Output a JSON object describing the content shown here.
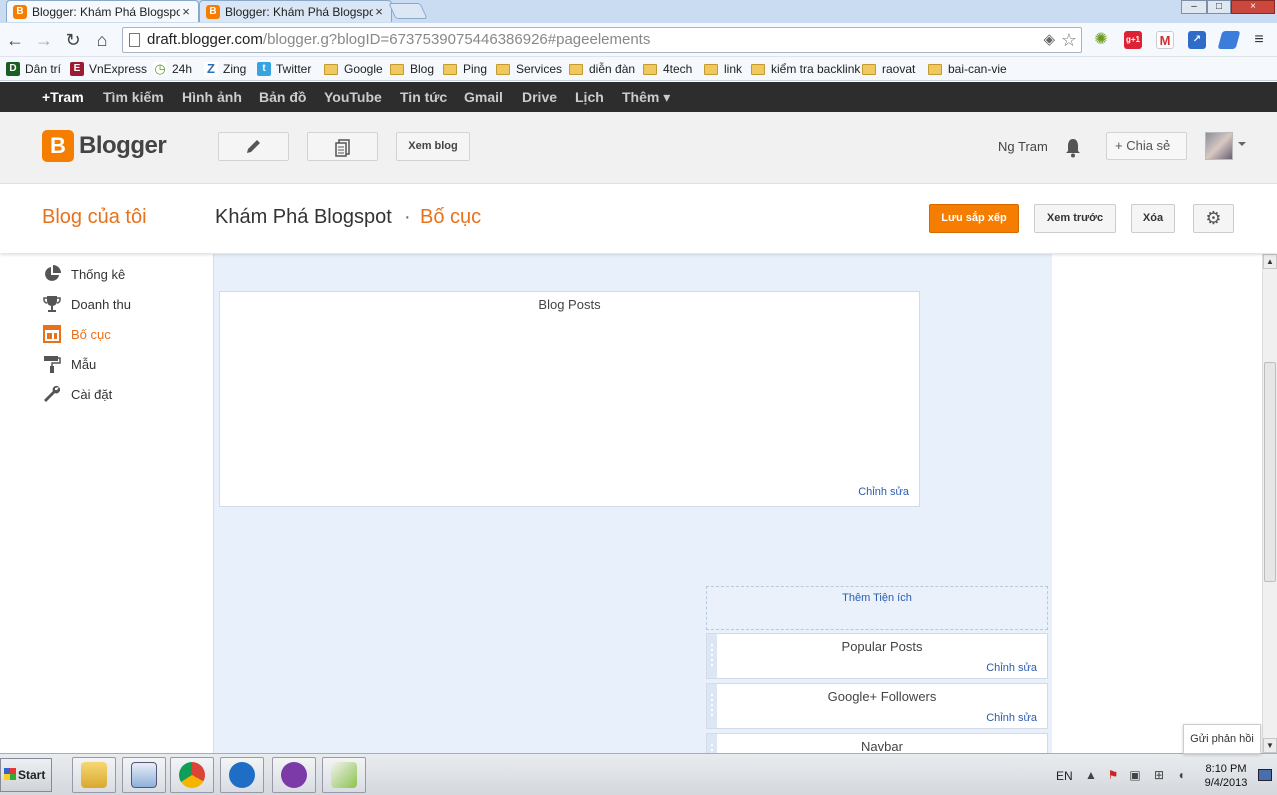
{
  "browser": {
    "tabs": [
      {
        "title": "Blogger: Khám Phá Blogspot",
        "active": true,
        "close": "×"
      },
      {
        "title": "Blogger: Khám Phá Blogspot",
        "active": false,
        "close": "×"
      }
    ],
    "window_controls": [
      "–",
      "□",
      "×"
    ],
    "url": {
      "host": "draft.blogger.com",
      "path": "/blogger.g?blogID=6737539075446386926#pageelements"
    },
    "nav": {
      "back": "←",
      "forward": "→",
      "reload": "↻",
      "home": "⌂"
    },
    "bookmarks": [
      {
        "label": "Dân trí",
        "icon": "dantri-icon",
        "color": "#1a5e20",
        "glyph": "D"
      },
      {
        "label": "VnExpress",
        "icon": "vnexpress-icon",
        "color": "#9b1c31",
        "glyph": "E"
      },
      {
        "label": "24h",
        "icon": "24h-icon",
        "color": "#5aa02c",
        "glyph": "◷"
      },
      {
        "label": "Zing",
        "icon": "zing-icon",
        "color": "#2e6fb6",
        "glyph": "Z"
      },
      {
        "label": "Twitter",
        "icon": "twitter-icon",
        "color": "#35a4e0",
        "glyph": "t"
      },
      {
        "label": "Google",
        "icon": "folder-icon"
      },
      {
        "label": "Blog",
        "icon": "folder-icon"
      },
      {
        "label": "Ping",
        "icon": "folder-icon"
      },
      {
        "label": "Services",
        "icon": "folder-icon"
      },
      {
        "label": "diễn đàn",
        "icon": "folder-icon"
      },
      {
        "label": "4tech",
        "icon": "folder-icon"
      },
      {
        "label": "link",
        "icon": "folder-icon"
      },
      {
        "label": "kiểm tra backlink",
        "icon": "folder-icon"
      },
      {
        "label": "raovat",
        "icon": "folder-icon"
      },
      {
        "label": "bai-can-vie",
        "icon": "folder-icon"
      }
    ]
  },
  "gbar": {
    "items": [
      "+Tram",
      "Tìm kiếm",
      "Hình ảnh",
      "Bản đồ",
      "YouTube",
      "Tin tức",
      "Gmail",
      "Drive",
      "Lịch",
      "Thêm ▾"
    ]
  },
  "header": {
    "logo_letter": "B",
    "logo_text": "Blogger",
    "view_blog": "Xem blog",
    "user_name": "Ng Tram",
    "share": "+  Chia sẻ"
  },
  "titlerow": {
    "my_blog": "Blog của tôi",
    "blog_name": "Khám Phá Blogspot",
    "separator": "·",
    "section": "Bố cục",
    "save_arrangement": "Lưu sắp xếp",
    "preview": "Xem trước",
    "clear": "Xóa"
  },
  "sidebar": {
    "items": [
      {
        "label": "Thống kê",
        "icon": "pie-chart-icon",
        "active": false
      },
      {
        "label": "Doanh thu",
        "icon": "trophy-icon",
        "active": false
      },
      {
        "label": "Bố cục",
        "icon": "layout-icon",
        "active": true
      },
      {
        "label": "Mẫu",
        "icon": "paint-roller-icon",
        "active": false
      },
      {
        "label": "Cài đặt",
        "icon": "wrench-icon",
        "active": false
      }
    ]
  },
  "layout": {
    "main_gadget": {
      "title": "Blog Posts",
      "edit": "Chỉnh sửa"
    },
    "add_gadget": "Thêm Tiện ích",
    "sidebar_gadgets": [
      {
        "title": "Popular Posts",
        "edit": "Chỉnh sửa"
      },
      {
        "title": "Google+ Followers",
        "edit": "Chỉnh sửa"
      },
      {
        "title": "Navbar",
        "edit": ""
      }
    ]
  },
  "feedback": "Gửi phản hồi",
  "taskbar": {
    "start": "Start",
    "apps": [
      "explorer-icon",
      "notepad-icon",
      "chrome-icon",
      "teamviewer-icon",
      "yahoo-messenger-icon",
      "editor-icon"
    ],
    "language": "EN",
    "time": "8:10 PM",
    "date": "9/4/2013"
  },
  "colors": {
    "accent": "#f57d00",
    "accent_text": "#e8711b",
    "link": "#2a5db0",
    "canvas": "#e8f0fb"
  }
}
